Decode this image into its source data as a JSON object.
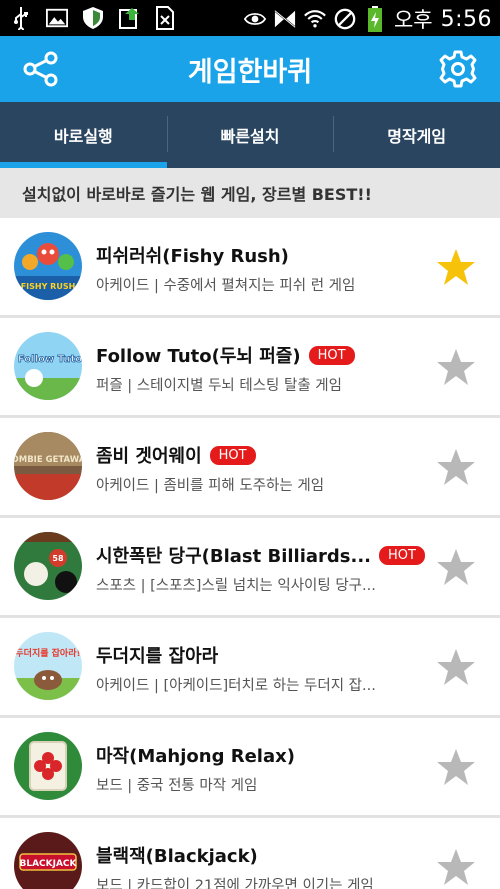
{
  "status_bar": {
    "ampm": "오후",
    "time": "5:56"
  },
  "header": {
    "title": "게임한바퀴"
  },
  "tabs": [
    {
      "label": "바로실행",
      "active": true
    },
    {
      "label": "빠른설치",
      "active": false
    },
    {
      "label": "명작게임",
      "active": false
    }
  ],
  "banner": "설치없이 바로바로 즐기는 웹 게임, 장르별 BEST!!",
  "hot_label": "HOT",
  "games": [
    {
      "name": "피쉬러쉬(Fishy Rush)",
      "hot": false,
      "desc": "아케이드 | 수중에서 펼쳐지는 피쉬 런 게임",
      "favorite": true,
      "thumb_text": "FISHY RUSH"
    },
    {
      "name": "Follow Tuto(두뇌 퍼즐)",
      "hot": true,
      "desc": "퍼즐 | 스테이지별 두뇌 테스팅 탈출 게임",
      "favorite": false,
      "thumb_text": "Follow Tuto"
    },
    {
      "name": "좀비 겟어웨이",
      "hot": true,
      "desc": "아케이드 | 좀비를 피해 도주하는 게임",
      "favorite": false,
      "thumb_text": "ZOMBIE GETAWAY"
    },
    {
      "name": "시한폭탄 당구(Blast Billiards...",
      "hot": true,
      "desc": "스포츠 | [스포츠]스릴 넘치는 익사이팅 당구...",
      "favorite": false,
      "thumb_text": "58"
    },
    {
      "name": "두더지를 잡아라",
      "hot": false,
      "desc": "아케이드 | [아케이드]터치로 하는 두더지 잡...",
      "favorite": false,
      "thumb_text": "두더지를 잡아라!"
    },
    {
      "name": "마작(Mahjong Relax)",
      "hot": false,
      "desc": "보드 | 중국 전통 마작 게임",
      "favorite": false,
      "thumb_text": ""
    },
    {
      "name": "블랙잭(Blackjack)",
      "hot": false,
      "desc": "보드 | 카드합이 21점에 가까우면 이기는 게임",
      "favorite": false,
      "thumb_text": "BLACKJACK"
    }
  ],
  "colors": {
    "header_blue": "#1aa3e8",
    "tab_navy": "#2a4560",
    "hot_red": "#e51b1b",
    "star_gold": "#f6c20a",
    "star_grey": "#b8b8b8"
  }
}
